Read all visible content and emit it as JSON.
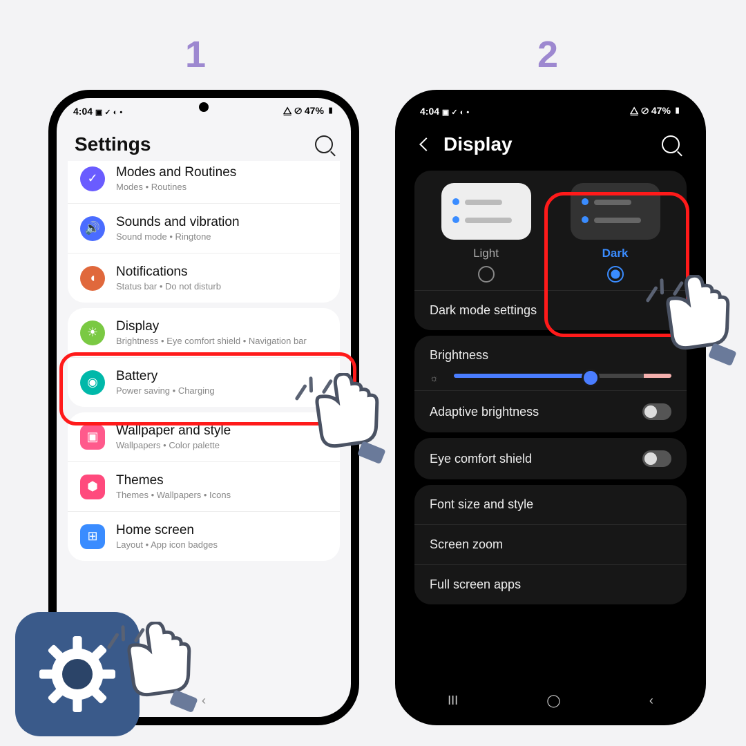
{
  "steps": {
    "s1": "1",
    "s2": "2"
  },
  "status": {
    "time": "4:04",
    "icons": "▣ ✓ ◐ •",
    "right": "⧋ ⊘ 47% ▮"
  },
  "settings": {
    "title": "Settings",
    "items": [
      {
        "title": "Modes and Routines",
        "sub": "Modes  •  Routines",
        "color": "#6a5cff",
        "glyph": "✓"
      },
      {
        "title": "Sounds and vibration",
        "sub": "Sound mode  •  Ringtone",
        "color": "#4a6cff",
        "glyph": "🔊"
      },
      {
        "title": "Notifications",
        "sub": "Status bar  •  Do not disturb",
        "color": "#e0683c",
        "glyph": "◖"
      },
      {
        "title": "Display",
        "sub": "Brightness  •  Eye comfort shield  •  Navigation bar",
        "color": "#7ac943",
        "glyph": "☀"
      },
      {
        "title": "Battery",
        "sub": "Power saving  •  Charging",
        "color": "#00b8a9",
        "glyph": "◉"
      },
      {
        "title": "Wallpaper and style",
        "sub": "Wallpapers  •  Color palette",
        "color": "#ff5a8c",
        "glyph": "▣"
      },
      {
        "title": "Themes",
        "sub": "Themes  •  Wallpapers  •  Icons",
        "color": "#ff4a7d",
        "glyph": "⬢"
      },
      {
        "title": "Home screen",
        "sub": "Layout  •  App icon badges",
        "color": "#3a8cff",
        "glyph": "⊞"
      }
    ]
  },
  "display": {
    "title": "Display",
    "light": "Light",
    "dark": "Dark",
    "dark_settings": "Dark mode settings",
    "brightness": "Brightness",
    "adaptive": "Adaptive brightness",
    "eye": "Eye comfort shield",
    "font": "Font size and style",
    "zoom": "Screen zoom",
    "full": "Full screen apps",
    "brightness_pct": 62
  }
}
